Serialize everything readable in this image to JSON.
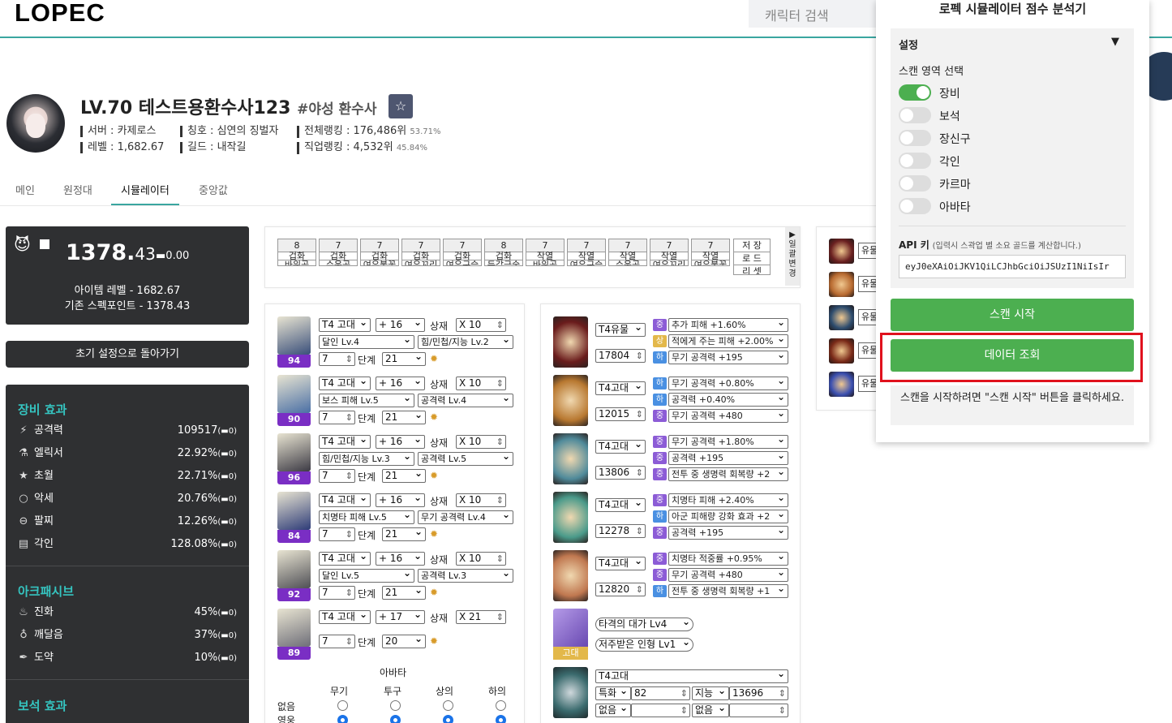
{
  "header": {
    "logo": "LOPEC",
    "search_placeholder": "캐릭터 검색"
  },
  "character": {
    "level_name": "LV.70 테스트용환수사123",
    "class": "#야성 환수사",
    "server": "서버 : 카제로스",
    "item_level": "레벨 : 1,682.67",
    "title": "칭호 : 심연의 징벌자",
    "guild": "길드 : 내작길",
    "total_rank": "전체랭킹 : 176,486위",
    "total_rank_pct": "53.71%",
    "class_rank": "직업랭킹 : 4,532위",
    "class_rank_pct": "45.84%"
  },
  "tabs": [
    "메인",
    "원정대",
    "시뮬레이터",
    "중앙값"
  ],
  "score": {
    "main": "1378.",
    "decimal": "43",
    "diff": "0.00",
    "item_level_line": "아이템 레벨 - 1682.67",
    "spec_line": "기존 스펙포인트 - 1378.43"
  },
  "reset_label": "초기 설정으로 돌아가기",
  "effects": {
    "equip_title": "장비 효과",
    "equip": [
      {
        "label": "공격력",
        "value": "109517",
        "diff": "(▬0)"
      },
      {
        "label": "엘릭서",
        "value": "22.92%",
        "diff": "(▬0)"
      },
      {
        "label": "초월",
        "value": "22.71%",
        "diff": "(▬0)"
      },
      {
        "label": "악세",
        "value": "20.76%",
        "diff": "(▬0)"
      },
      {
        "label": "팔찌",
        "value": "12.26%",
        "diff": "(▬0)"
      },
      {
        "label": "각인",
        "value": "128.08%",
        "diff": "(▬0)"
      }
    ],
    "ark_title": "아크패시브",
    "ark": [
      {
        "label": "진화",
        "value": "45%",
        "diff": "(▬0)"
      },
      {
        "label": "깨달음",
        "value": "37%",
        "diff": "(▬0)"
      },
      {
        "label": "도약",
        "value": "10%",
        "diff": "(▬0)"
      }
    ],
    "gem_title": "보석 효과"
  },
  "gem_bar": {
    "items": [
      {
        "v": "8",
        "t": "겁화",
        "n": "바위곰"
      },
      {
        "v": "7",
        "t": "겁화",
        "n": "슈웅곰"
      },
      {
        "v": "7",
        "t": "겁화",
        "n": "여우불꽃"
      },
      {
        "v": "7",
        "t": "겁화",
        "n": "여우꼬리"
      },
      {
        "v": "7",
        "t": "겁화",
        "n": "여우구슬"
      },
      {
        "v": "8",
        "t": "겁화",
        "n": "둔갑금술"
      },
      {
        "v": "7",
        "t": "작열",
        "n": "바위곰"
      },
      {
        "v": "7",
        "t": "작열",
        "n": "여우구슬"
      },
      {
        "v": "7",
        "t": "작열",
        "n": "슈웅곰"
      },
      {
        "v": "7",
        "t": "작열",
        "n": "여우꼬리"
      },
      {
        "v": "7",
        "t": "작열",
        "n": "여우불꽃"
      }
    ],
    "save": "저 장",
    "load": "로 드",
    "reset": "리 셋",
    "vertical": "▶ 일괄변경"
  },
  "armor": {
    "labels": {
      "transcend": "상재",
      "stage": "단계"
    },
    "rows": [
      {
        "num": "94",
        "tier": "T4 고대",
        "refine": "+ 16",
        "trans": "X 10",
        "ela1": "달인 Lv.4",
        "ela2": "힘/민첩/지능 Lv.2",
        "lv": "7",
        "stage": "21"
      },
      {
        "num": "90",
        "tier": "T4 고대",
        "refine": "+ 16",
        "trans": "X 10",
        "ela1": "보스 피해 Lv.5",
        "ela2": "공격력 Lv.4",
        "lv": "7",
        "stage": "21"
      },
      {
        "num": "96",
        "tier": "T4 고대",
        "refine": "+ 16",
        "trans": "X 10",
        "ela1": "힘/민첩/지능 Lv.3",
        "ela2": "공격력 Lv.5",
        "lv": "7",
        "stage": "21"
      },
      {
        "num": "84",
        "tier": "T4 고대",
        "refine": "+ 16",
        "trans": "X 10",
        "ela1": "치명타 피해 Lv.5",
        "ela2": "무기 공격력 Lv.4",
        "lv": "7",
        "stage": "21"
      },
      {
        "num": "92",
        "tier": "T4 고대",
        "refine": "+ 16",
        "trans": "X 10",
        "ela1": "달인 Lv.5",
        "ela2": "공격력 Lv.3",
        "lv": "7",
        "stage": "21"
      },
      {
        "num": "89",
        "tier": "T4 고대",
        "refine": "+ 17",
        "trans": "X 21",
        "lv": "7",
        "stage": "20"
      }
    ],
    "avatar": {
      "title": "아바타",
      "cols": [
        "무기",
        "투구",
        "상의",
        "하의"
      ],
      "rows": [
        "없음",
        "영웅"
      ]
    }
  },
  "acc": {
    "rows": [
      {
        "tier": "T4유물",
        "stat": "17804",
        "opts": [
          {
            "g": "중",
            "t": "추가 피해 +1.60%"
          },
          {
            "g": "상",
            "t": "적에게 주는 피해 +2.00%"
          },
          {
            "g": "하",
            "t": "무기 공격력 +195"
          }
        ]
      },
      {
        "tier": "T4고대",
        "stat": "12015",
        "opts": [
          {
            "g": "하",
            "t": "무기 공격력 +0.80%"
          },
          {
            "g": "하",
            "t": "공격력 +0.40%"
          },
          {
            "g": "중",
            "t": "무기 공격력 +480"
          }
        ]
      },
      {
        "tier": "T4고대",
        "stat": "13806",
        "opts": [
          {
            "g": "중",
            "t": "무기 공격력 +1.80%"
          },
          {
            "g": "중",
            "t": "공격력 +195"
          },
          {
            "g": "중",
            "t": "전투 중 생명력 회복량 +2"
          }
        ]
      },
      {
        "tier": "T4고대",
        "stat": "12278",
        "opts": [
          {
            "g": "중",
            "t": "치명타 피해 +2.40%"
          },
          {
            "g": "하",
            "t": "아군 피해량 강화 효과 +2"
          },
          {
            "g": "중",
            "t": "공격력 +195"
          }
        ]
      },
      {
        "tier": "T4고대",
        "stat": "12820",
        "opts": [
          {
            "g": "중",
            "t": "치명타 적중률 +0.95%"
          },
          {
            "g": "중",
            "t": "무기 공격력 +480"
          },
          {
            "g": "하",
            "t": "전투 중 생명력 회복량 +1"
          }
        ]
      }
    ],
    "stone": {
      "badge": "고대",
      "e1": "타격의 대가 Lv4",
      "e2": "저주받은 인형 Lv1"
    },
    "bracelet": {
      "tier": "T4고대",
      "s1": "특화",
      "v1": "82",
      "s2": "지능",
      "v2": "13696",
      "e1": "없음",
      "e2": "없음"
    }
  },
  "gem_side": {
    "label": "유물"
  },
  "extension": {
    "title": "로펙 시뮬레이터 점수 분석기",
    "settings": "설정",
    "arrow": "▼",
    "scan_label": "스캔 영역 선택",
    "toggles": [
      {
        "label": "장비",
        "on": true
      },
      {
        "label": "보석",
        "on": false
      },
      {
        "label": "장신구",
        "on": false
      },
      {
        "label": "각인",
        "on": false
      },
      {
        "label": "카르마",
        "on": false
      },
      {
        "label": "아바타",
        "on": false
      }
    ],
    "api_label": "API 키",
    "api_hint": "(입력시 스곽업 별 소요 골드를 계산합니다.)",
    "api_value": "eyJ0eXAiOiJKV1QiLCJhbGciOiJSUzI1NiIsIr",
    "scan_btn": "스캔 시작",
    "data_btn": "데이터 조회",
    "msg": "스캔을 시작하려면 \"스캔 시작\" 버튼을 클릭하세요."
  },
  "colors": {
    "accent": "#3aa6a0",
    "dark_panel": "#2f3032",
    "green": "#4caf50",
    "highlight": "#e0111d",
    "grade_purple": "#7a2ec4"
  }
}
